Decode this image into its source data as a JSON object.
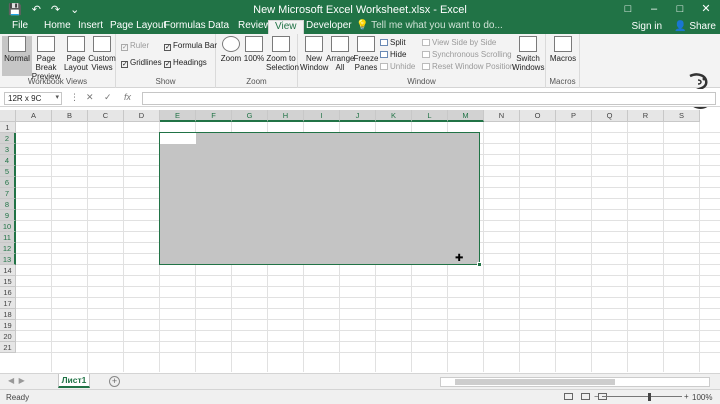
{
  "window": {
    "title": "New Microsoft Excel Worksheet.xlsx - Excel",
    "qat": [
      "save-icon",
      "undo-icon",
      "redo-icon",
      "customize-icon"
    ],
    "controls": [
      "ribbon-display-icon",
      "minimize-icon",
      "maximize-icon",
      "close-icon"
    ]
  },
  "tabs": [
    {
      "label": "File"
    },
    {
      "label": "Home"
    },
    {
      "label": "Insert"
    },
    {
      "label": "Page Layout"
    },
    {
      "label": "Formulas"
    },
    {
      "label": "Data"
    },
    {
      "label": "Review"
    },
    {
      "label": "View",
      "active": true
    },
    {
      "label": "Developer"
    }
  ],
  "tell_me": "Tell me what you want to do...",
  "signin": "Sign in",
  "share": "Share",
  "ribbon": {
    "workbook_views": {
      "label": "Workbook Views",
      "normal": "Normal",
      "page_break": "Page Break Preview",
      "page_layout": "Page Layout",
      "custom_views": "Custom Views"
    },
    "show": {
      "label": "Show",
      "ruler": "Ruler",
      "formula_bar": "Formula Bar",
      "gridlines": "Gridlines",
      "headings": "Headings"
    },
    "zoom": {
      "label": "Zoom",
      "zoom": "Zoom",
      "hundred": "100%",
      "zoom_to_selection": "Zoom to Selection"
    },
    "window": {
      "label": "Window",
      "new_window": "New Window",
      "arrange_all": "Arrange All",
      "freeze_panes": "Freeze Panes",
      "split": "Split",
      "hide": "Hide",
      "unhide": "Unhide",
      "view_side": "View Side by Side",
      "sync_scroll": "Synchronous Scrolling",
      "reset_pos": "Reset Window Position",
      "switch_windows": "Switch Windows"
    },
    "macros": {
      "label": "Macros",
      "macros": "Macros"
    }
  },
  "formula_bar": {
    "name_box": "12R x 9C",
    "cancel": "✕",
    "enter": "✓",
    "fx": "fx",
    "value": ""
  },
  "columns": [
    "A",
    "B",
    "C",
    "D",
    "E",
    "F",
    "G",
    "H",
    "I",
    "J",
    "K",
    "L",
    "M",
    "N",
    "O",
    "P",
    "Q",
    "R",
    "S"
  ],
  "rows": [
    "1",
    "2",
    "3",
    "4",
    "5",
    "6",
    "7",
    "8",
    "9",
    "10",
    "11",
    "12",
    "13",
    "14",
    "15",
    "16",
    "17",
    "18",
    "19",
    "20",
    "21"
  ],
  "sheets": [
    {
      "name": "Лист1",
      "active": true
    }
  ],
  "status": {
    "ready": "Ready",
    "zoom": "100%",
    "zoom_minus": "−",
    "zoom_plus": "+"
  }
}
